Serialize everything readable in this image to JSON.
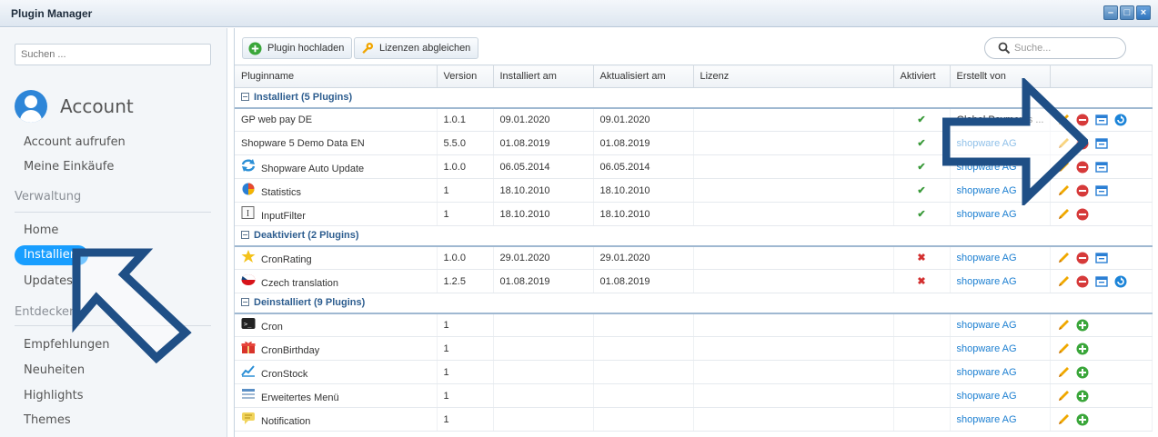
{
  "window": {
    "title": "Plugin Manager"
  },
  "sidebar": {
    "search_placeholder": "Suchen ...",
    "account_title": "Account",
    "items_account": [
      "Account aufrufen",
      "Meine Einkäufe"
    ],
    "section_verwaltung": "Verwaltung",
    "items_verwaltung": [
      "Home",
      "Installiert",
      "Updates"
    ],
    "section_entdecken": "Entdecken",
    "items_entdecken": [
      "Empfehlungen",
      "Neuheiten",
      "Highlights",
      "Themes"
    ]
  },
  "toolbar": {
    "upload_label": "Plugin hochladen",
    "licenses_label": "Lizenzen abgleichen",
    "search_placeholder": "Suche..."
  },
  "columns": [
    "Pluginname",
    "Version",
    "Installiert am",
    "Aktualisiert am",
    "Lizenz",
    "Aktiviert",
    "Erstellt von",
    ""
  ],
  "groups": [
    {
      "label": "Installiert (5 Plugins)",
      "rows": [
        {
          "name": "GP web pay DE",
          "version": "1.0.1",
          "installed": "09.01.2020",
          "updated": "09.01.2020",
          "active": "✔",
          "author": "Global Payments ...",
          "icon": "none"
        },
        {
          "name": "Shopware 5 Demo Data EN",
          "version": "5.5.0",
          "installed": "01.08.2019",
          "updated": "01.08.2019",
          "active": "✔",
          "author": "shopware AG",
          "icon": "none"
        },
        {
          "name": "Shopware Auto Update",
          "version": "1.0.0",
          "installed": "06.05.2014",
          "updated": "06.05.2014",
          "active": "✔",
          "author": "shopware AG",
          "icon": "refresh-icon"
        },
        {
          "name": "Statistics",
          "version": "1",
          "installed": "18.10.2010",
          "updated": "18.10.2010",
          "active": "✔",
          "author": "shopware AG",
          "icon": "pie-chart-icon"
        },
        {
          "name": "InputFilter",
          "version": "1",
          "installed": "18.10.2010",
          "updated": "18.10.2010",
          "active": "✔",
          "author": "shopware AG",
          "icon": "text-cursor-icon"
        }
      ]
    },
    {
      "label": "Deaktiviert (2 Plugins)",
      "rows": [
        {
          "name": "CronRating",
          "version": "1.0.0",
          "installed": "29.01.2020",
          "updated": "29.01.2020",
          "active": "✖",
          "author": "shopware AG",
          "icon": "star-icon"
        },
        {
          "name": "Czech translation",
          "version": "1.2.5",
          "installed": "01.08.2019",
          "updated": "01.08.2019",
          "active": "✖",
          "author": "shopware AG",
          "icon": "flag-icon"
        }
      ]
    },
    {
      "label": "Deinstalliert (9 Plugins)",
      "rows": [
        {
          "name": "Cron",
          "version": "1",
          "installed": "",
          "updated": "",
          "active": "",
          "author": "shopware AG",
          "icon": "terminal-icon"
        },
        {
          "name": "CronBirthday",
          "version": "1",
          "installed": "",
          "updated": "",
          "active": "",
          "author": "shopware AG",
          "icon": "gift-icon"
        },
        {
          "name": "CronStock",
          "version": "1",
          "installed": "",
          "updated": "",
          "active": "",
          "author": "shopware AG",
          "icon": "chart-line-icon"
        },
        {
          "name": "Erweitertes Menü",
          "version": "1",
          "installed": "",
          "updated": "",
          "active": "",
          "author": "shopware AG",
          "icon": "menu-icon"
        },
        {
          "name": "Notification",
          "version": "1",
          "installed": "",
          "updated": "",
          "active": "",
          "author": "shopware AG",
          "icon": "speech-icon"
        }
      ]
    }
  ],
  "colors": {
    "accent": "#189eff",
    "link": "#1c7fd1",
    "arrow": "#1f4f86"
  }
}
